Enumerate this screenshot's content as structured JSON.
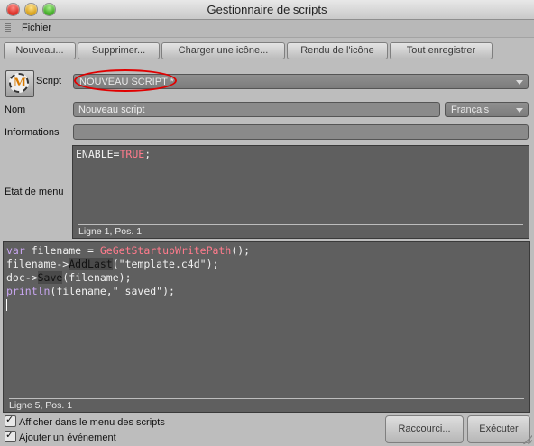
{
  "window": {
    "title": "Gestionnaire de scripts"
  },
  "menu": {
    "file": "Fichier"
  },
  "toolbar": {
    "new": "Nouveau...",
    "delete": "Supprimer...",
    "load_icon": "Charger une icône...",
    "render_icon": "Rendu de l'icône",
    "save_all": "Tout enregistrer"
  },
  "script": {
    "label": "Script",
    "selected": "NOUVEAU SCRIPT *"
  },
  "name": {
    "label": "Nom",
    "value": "Nouveau script",
    "language": "Français"
  },
  "info": {
    "label": "Informations",
    "value": ""
  },
  "menu_state": {
    "label": "Etat de menu",
    "code": {
      "l1_a": "ENABLE",
      "l1_b": "=",
      "l1_c": "TRUE",
      "l1_d": ";"
    },
    "status": "Ligne 1, Pos. 1"
  },
  "main_code": {
    "l1_kw": "var",
    "l1_a": " filename = ",
    "l1_fn": "GeGetStartupWritePath",
    "l1_b": "();",
    "l2_a": "filename->",
    "l2_fn": "AddLast",
    "l2_b": "(\"template.c4d\");",
    "l3_a": "doc->",
    "l3_fn": "Save",
    "l3_b": "(filename);",
    "l4_kw": "println",
    "l4_b": "(filename,\" saved\");",
    "status": "Ligne 5, Pos. 1"
  },
  "options": {
    "show_in_menu": "Afficher dans le menu des scripts",
    "add_event": "Ajouter un événement"
  },
  "actions": {
    "shortcut": "Raccourci...",
    "execute": "Exécuter"
  },
  "colors": {
    "accent_highlight": "#e00000",
    "keyword": "#c8a6f0",
    "function": "#ff7b8c",
    "editor_bg": "#5f5f5f"
  }
}
